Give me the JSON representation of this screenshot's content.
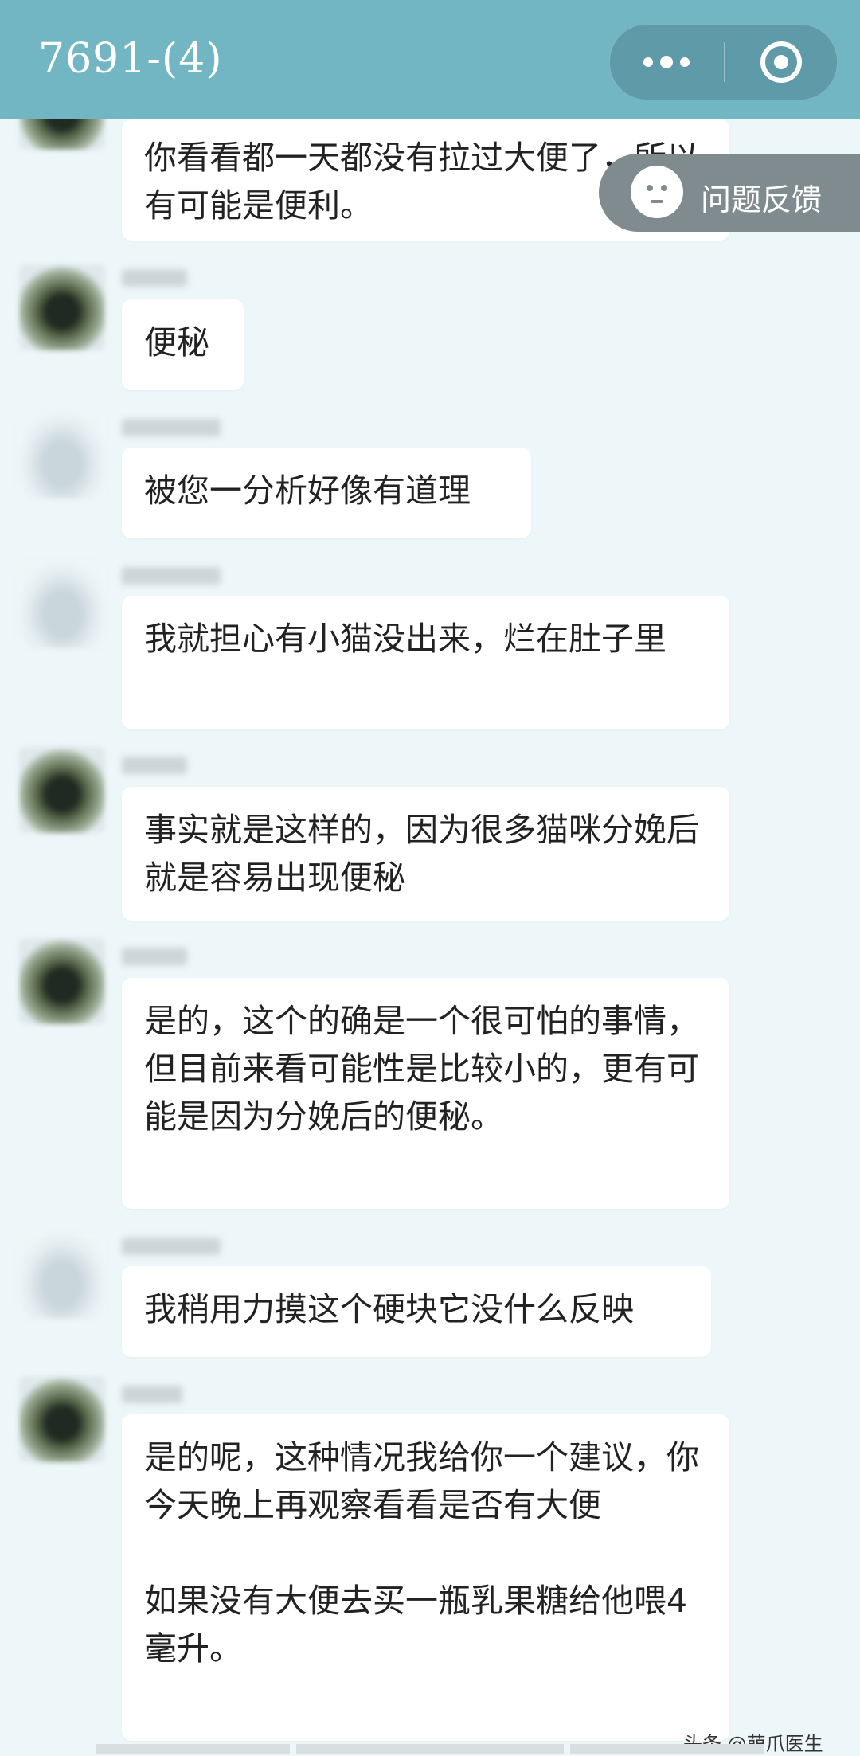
{
  "header": {
    "title": "7691-(4)",
    "more_icon": "more-dots-icon",
    "close_icon": "target-close-icon"
  },
  "feedback": {
    "label": "问题反馈",
    "icon": "face-icon"
  },
  "messages": [
    {
      "sender": "doctor",
      "text": "你看看都一天都没有拉过大便了，所以有可能是便利。"
    },
    {
      "sender": "doctor",
      "text": "便秘"
    },
    {
      "sender": "user",
      "text": "被您一分析好像有道理"
    },
    {
      "sender": "user",
      "text": "我就担心有小猫没出来，烂在肚子里"
    },
    {
      "sender": "doctor",
      "text": "事实就是这样的，因为很多猫咪分娩后就是容易出现便秘"
    },
    {
      "sender": "doctor",
      "text": "是的，这个的确是一个很可怕的事情，但目前来看可能性是比较小的，更有可能是因为分娩后的便秘。"
    },
    {
      "sender": "user",
      "text": "我稍用力摸这个硬块它没什么反映"
    },
    {
      "sender": "doctor",
      "text": "是的呢，这种情况我给你一个建议，你今天晚上再观察看看是否有大便\n\n如果没有大便去买一瓶乳果糖给他喂4毫升。"
    }
  ],
  "watermark": "头条 @萌爪医生"
}
